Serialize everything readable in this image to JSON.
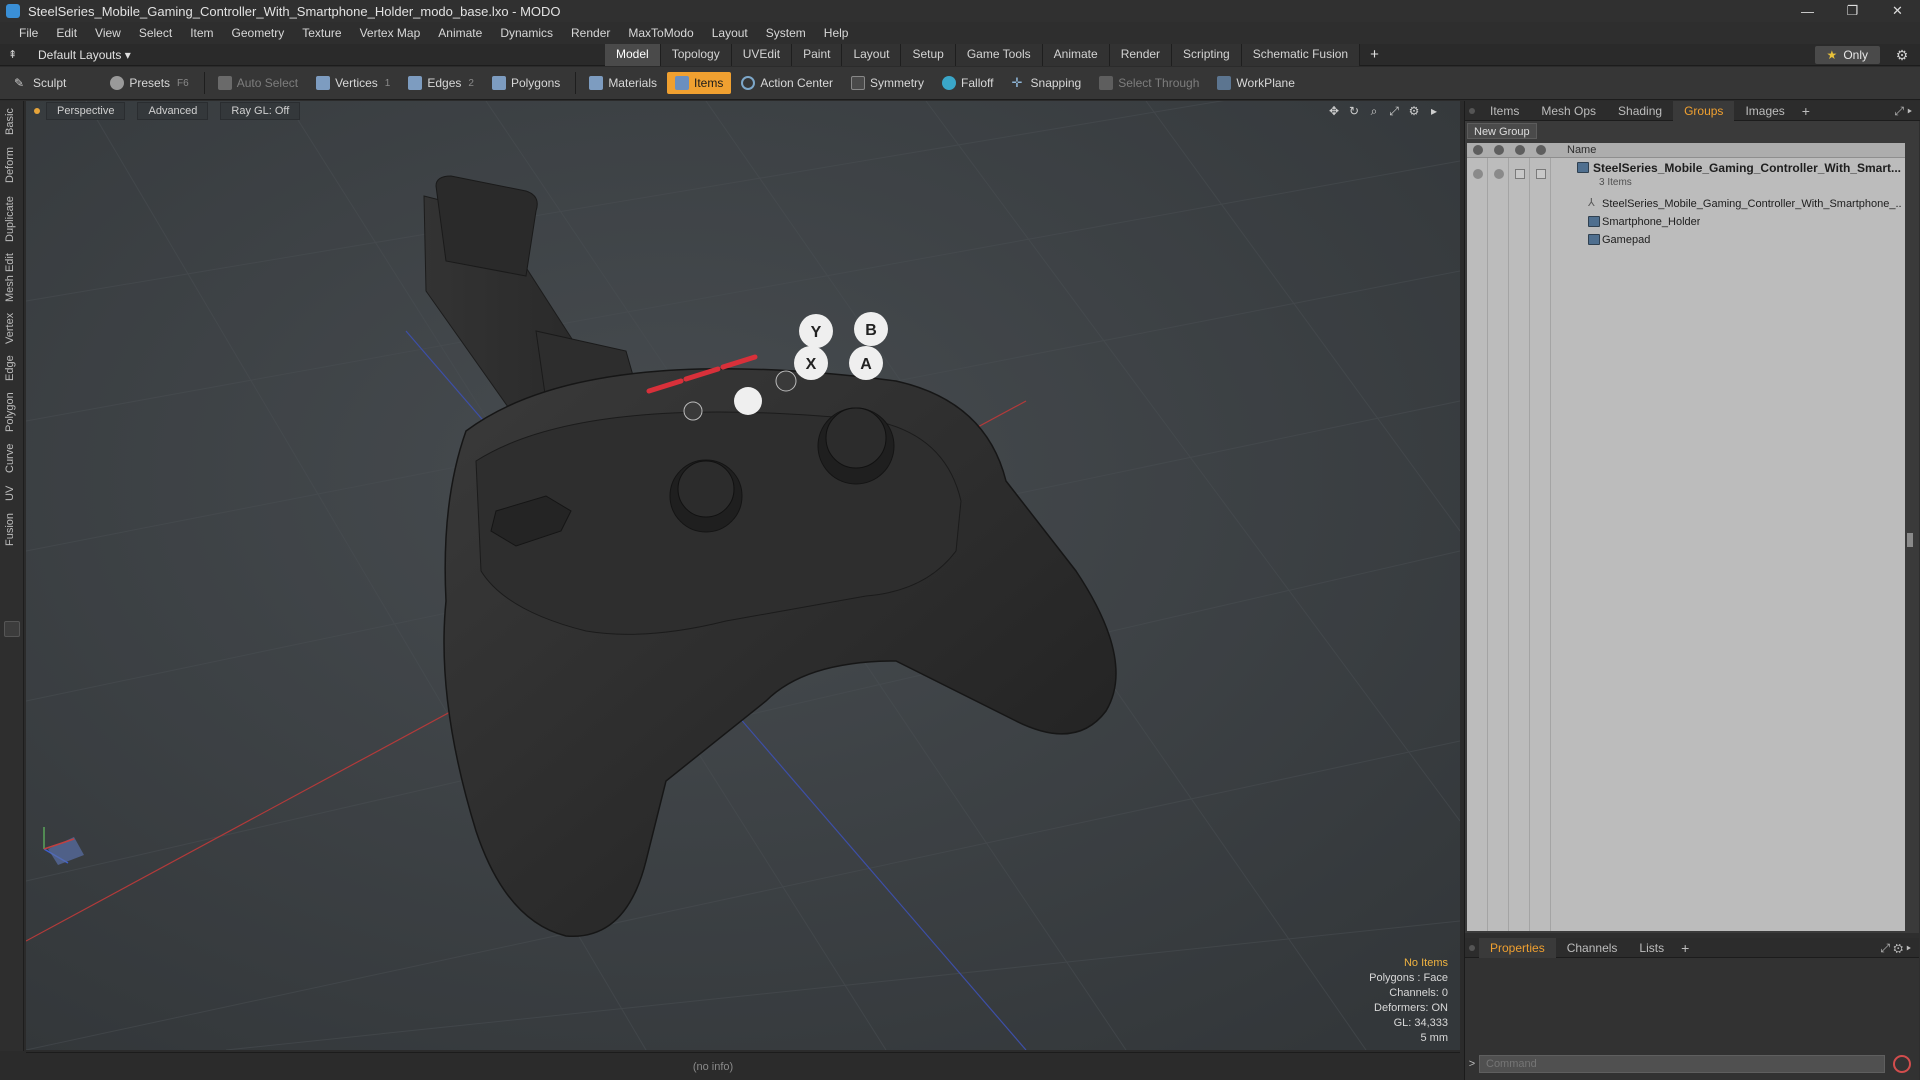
{
  "window": {
    "title": "SteelSeries_Mobile_Gaming_Controller_With_Smartphone_Holder_modo_base.lxo - MODO",
    "controls": {
      "minimize": "—",
      "restore": "❐",
      "close": "✕"
    }
  },
  "menu": [
    "File",
    "Edit",
    "View",
    "Select",
    "Item",
    "Geometry",
    "Texture",
    "Vertex Map",
    "Animate",
    "Dynamics",
    "Render",
    "MaxToModo",
    "Layout",
    "System",
    "Help"
  ],
  "layout_bar": {
    "layout_select": "Default Layouts ▾",
    "tabs": [
      "Model",
      "Topology",
      "UVEdit",
      "Paint",
      "Layout",
      "Setup",
      "Game Tools",
      "Animate",
      "Render",
      "Scripting",
      "Schematic Fusion"
    ],
    "active_tab": "Model",
    "add_tab": "+",
    "only_label": "Only"
  },
  "toolbar": {
    "sculpt": "Sculpt",
    "presets": "Presets",
    "presets_key": "F6",
    "auto_select": "Auto Select",
    "vertices": "Vertices",
    "vertices_key": "1",
    "edges": "Edges",
    "edges_key": "2",
    "polygons": "Polygons",
    "materials": "Materials",
    "items": "Items",
    "action_center": "Action Center",
    "symmetry": "Symmetry",
    "falloff": "Falloff",
    "snapping": "Snapping",
    "select_through": "Select Through",
    "workplane": "WorkPlane"
  },
  "left_strip": [
    "Basic",
    "Deform",
    "Duplicate",
    "Mesh Edit",
    "Vertex",
    "Edge",
    "Polygon",
    "Curve",
    "UV",
    "Fusion"
  ],
  "viewport": {
    "view_mode": "Perspective",
    "shading": "Advanced",
    "raygl": "Ray GL: Off",
    "hud": {
      "status": "No Items",
      "polygons": "Polygons : Face",
      "channels": "Channels: 0",
      "deformers": "Deformers: ON",
      "gl": "GL: 34,333",
      "scale": "5 mm"
    },
    "controller_buttons": [
      "Y",
      "B",
      "X",
      "A"
    ]
  },
  "status_bar": {
    "info": "(no info)"
  },
  "right_panel": {
    "tabs": [
      "Items",
      "Mesh Ops",
      "Shading",
      "Groups",
      "Images"
    ],
    "active_tab": "Groups",
    "add_tab": "+",
    "new_group": "New Group",
    "column_name": "Name",
    "tree": {
      "group_name": "SteelSeries_Mobile_Gaming_Controller_With_Smart...",
      "group_count": "3 Items",
      "children": [
        "SteelSeries_Mobile_Gaming_Controller_With_Smartphone_...",
        "Smartphone_Holder",
        "Gamepad"
      ]
    },
    "bottom_tabs": [
      "Properties",
      "Channels",
      "Lists"
    ],
    "bottom_active": "Properties",
    "command_prompt": ">",
    "command_placeholder": "Command"
  },
  "colors": {
    "accent": "#f0a030",
    "viewport_bg": "#3d4144",
    "model": "#2f2f2f",
    "led": "#d8303a"
  }
}
